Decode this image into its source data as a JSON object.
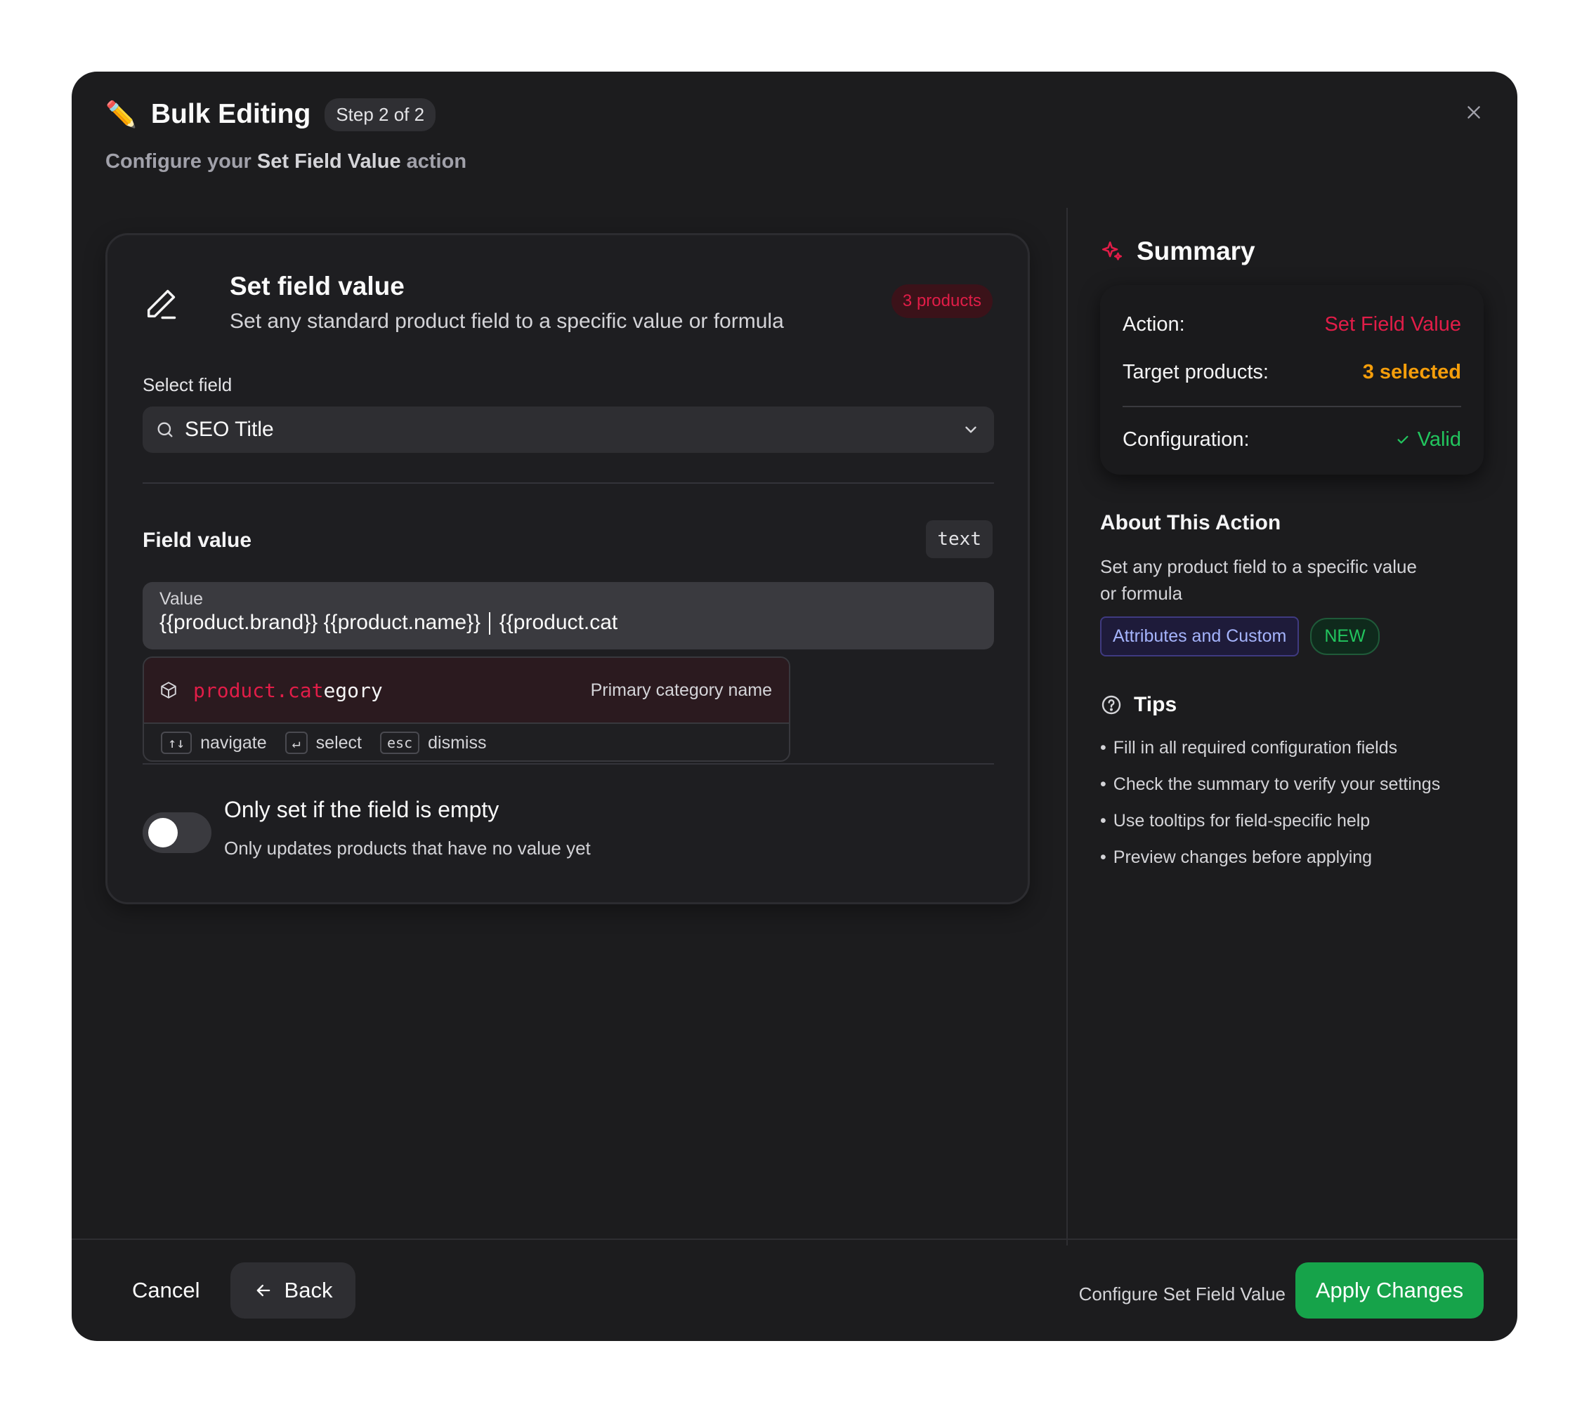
{
  "header": {
    "emoji": "✏️",
    "title": "Bulk Editing",
    "step": "Step 2 of 2",
    "subtitle_prefix": "Configure your ",
    "subtitle_action": "Set Field Value",
    "subtitle_suffix": " action"
  },
  "card": {
    "title": "Set field value",
    "description": "Set any standard product field to a specific value or formula",
    "products_badge": "3 products",
    "select_label": "Select field",
    "select_value": "SEO Title",
    "field_value_label": "Field value",
    "type_badge": "text",
    "value_label": "Value",
    "value_before_cursor": "{{product.brand}} {{product.name}}",
    "value_after_cursor": "{{product.cat",
    "suggestion": {
      "match": "product.cat",
      "rest": "egory",
      "description": "Primary category name"
    },
    "hints": {
      "navigate_key": "↑↓",
      "navigate": "navigate",
      "select_key": "↵",
      "select": "select",
      "dismiss_key": "esc",
      "dismiss": "dismiss"
    },
    "toggle": {
      "on": false,
      "title": "Only set if the field is empty",
      "description": "Only updates products that have no value yet"
    }
  },
  "summary": {
    "title": "Summary",
    "action_label": "Action:",
    "action_value": "Set Field Value",
    "target_label": "Target products:",
    "target_value": "3 selected",
    "config_label": "Configuration:",
    "config_value": "Valid"
  },
  "about": {
    "title": "About This Action",
    "description": "Set any product field to a specific value or formula",
    "chip": "Attributes and Custom",
    "new_badge": "NEW"
  },
  "tips": {
    "title": "Tips",
    "items": [
      "Fill in all required configuration fields",
      "Check the summary to verify your settings",
      "Use tooltips for field-specific help",
      "Preview changes before applying"
    ]
  },
  "footer": {
    "cancel": "Cancel",
    "back": "Back",
    "hint": "Configure Set Field Value",
    "apply": "Apply Changes"
  },
  "colors": {
    "accent_red": "#e11d48",
    "accent_amber": "#f59e0b",
    "accent_green": "#22c55e",
    "primary_button": "#16a34a",
    "modal_bg": "#1c1c1e"
  }
}
